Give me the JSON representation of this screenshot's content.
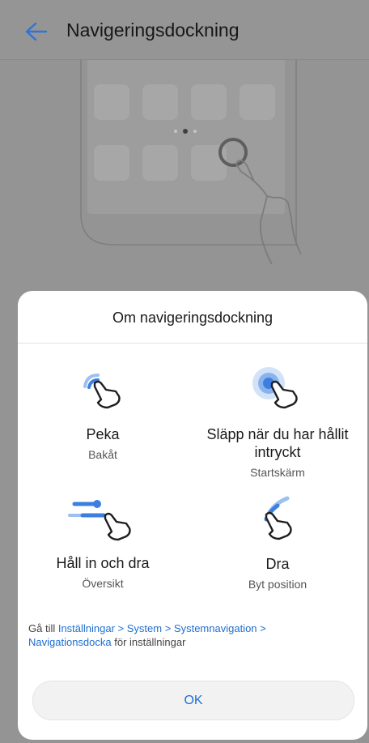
{
  "header": {
    "title": "Navigeringsdockning"
  },
  "dialog": {
    "title": "Om navigeringsdockning",
    "gestures": [
      {
        "label": "Peka",
        "sub": "Bakåt",
        "icon": "tap-gesture-icon"
      },
      {
        "label": "Släpp när du har hållit intryckt",
        "sub": "Startskärm",
        "icon": "press-release-gesture-icon"
      },
      {
        "label": "Håll in och dra",
        "sub": "Översikt",
        "icon": "hold-drag-gesture-icon"
      },
      {
        "label": "Dra",
        "sub": "Byt position",
        "icon": "drag-gesture-icon"
      }
    ],
    "hint": {
      "prefix": "Gå till ",
      "path1": "Inställningar > System > Systemnavigation >",
      "path2": "Navigationsdocka",
      "suffix": " för inställningar"
    },
    "ok_label": "OK"
  },
  "colors": {
    "accent": "#1e6fd0",
    "icon_blue": "#3c7fe0"
  }
}
